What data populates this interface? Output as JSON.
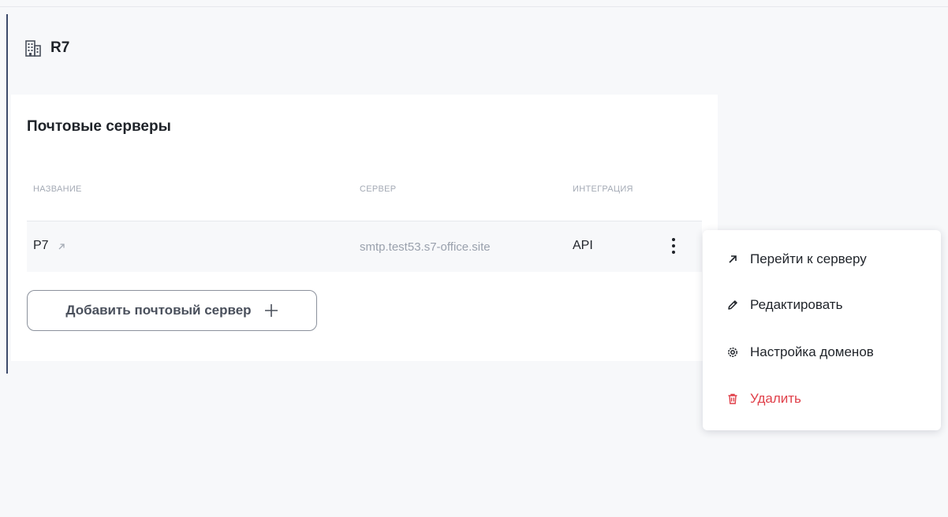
{
  "organization": {
    "name": "R7",
    "icon": "building-icon"
  },
  "mail_servers": {
    "title": "Почтовые серверы",
    "columns": {
      "name": "НАЗВАНИЕ",
      "server": "СЕРВЕР",
      "integration": "ИНТЕГРАЦИЯ"
    },
    "rows": [
      {
        "name": "P7",
        "server": "smtp.test53.s7-office.site",
        "integration": "API"
      }
    ],
    "add_button_label": "Добавить почтовый сервер"
  },
  "context_menu": {
    "items": [
      {
        "label": "Перейти к серверу",
        "icon": "arrow-up-right-icon"
      },
      {
        "label": "Редактировать",
        "icon": "pencil-icon"
      },
      {
        "label": "Настройка доменов",
        "icon": "gear-icon"
      },
      {
        "label": "Удалить",
        "icon": "trash-icon"
      }
    ]
  },
  "colors": {
    "background": "#f7f8fa",
    "card": "#ffffff",
    "text": "#1f2329",
    "muted": "#a4aab5",
    "danger": "#e0404a"
  }
}
